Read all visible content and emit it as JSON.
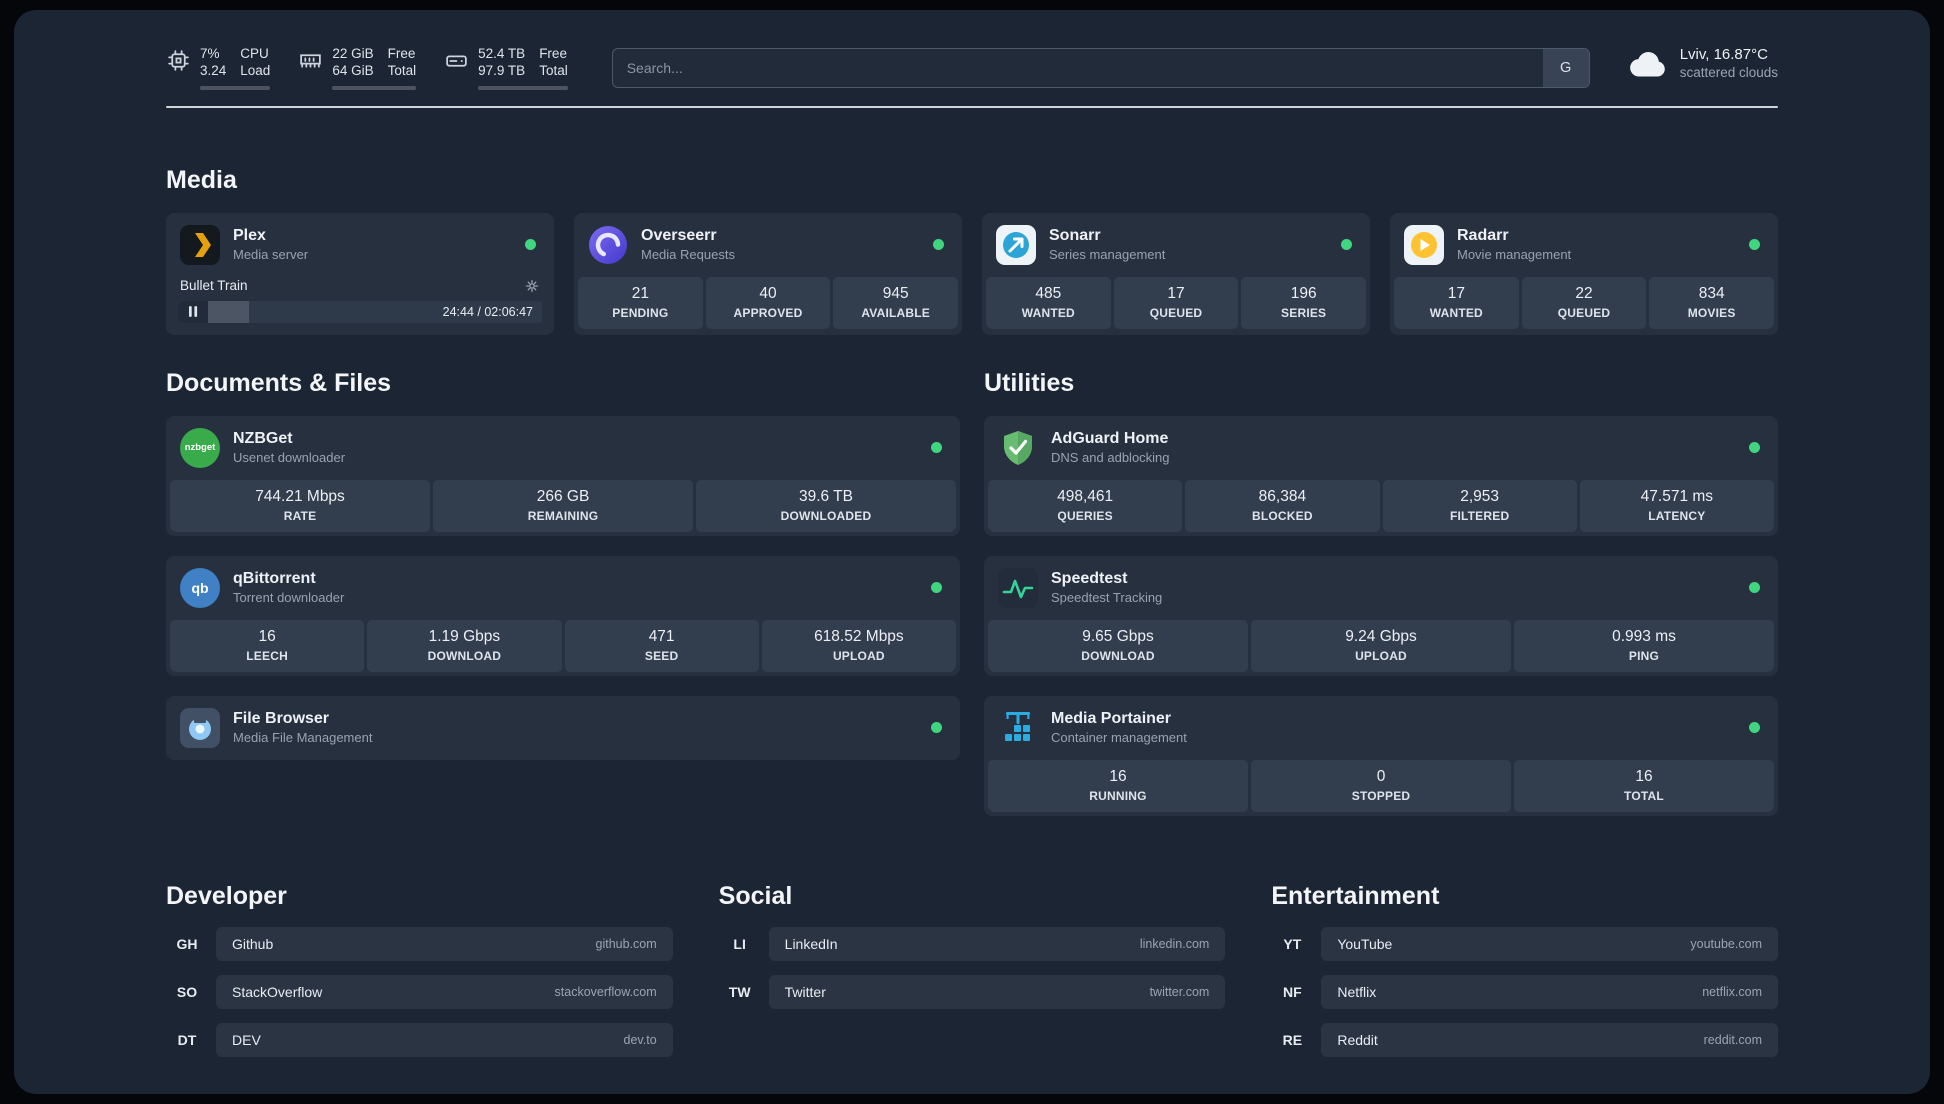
{
  "colors": {
    "status_green": "#3fd67f",
    "plex_amber": "#e5a00d",
    "adguard_green": "#68bc71",
    "portainer_blue": "#2aabe2",
    "speedtest_green": "#34d399"
  },
  "topbar": {
    "cpu": {
      "icon": "chip-icon",
      "percent": "7%",
      "load": "3.24",
      "label1": "CPU",
      "label2": "Load",
      "bar_percent": 7
    },
    "ram": {
      "icon": "memory-icon",
      "free": "22 GiB",
      "free_label": "Free",
      "total": "64 GiB",
      "total_label": "Total",
      "bar_percent": 66
    },
    "disk": {
      "icon": "hdd-icon",
      "free": "52.4 TB",
      "free_label": "Free",
      "total": "97.9 TB",
      "total_label": "Total",
      "bar_percent": 47
    },
    "search": {
      "placeholder": "Search...",
      "engine": "G"
    },
    "weather": {
      "icon": "cloud-icon",
      "location_temp": "Lviv, 16.87°C",
      "condition": "scattered clouds"
    }
  },
  "media": {
    "title": "Media",
    "plex": {
      "icon": "plex-icon",
      "name": "Plex",
      "subtitle": "Media server",
      "now_playing": "Bullet Train",
      "time": "24:44 / 02:06:47",
      "progress_percent": 19.5
    },
    "services": [
      {
        "icon": "overseerr-icon",
        "name": "Overseerr",
        "subtitle": "Media Requests",
        "stats": [
          {
            "value": "21",
            "label": "PENDING"
          },
          {
            "value": "40",
            "label": "APPROVED"
          },
          {
            "value": "945",
            "label": "AVAILABLE"
          }
        ]
      },
      {
        "icon": "sonarr-icon",
        "name": "Sonarr",
        "subtitle": "Series management",
        "stats": [
          {
            "value": "485",
            "label": "WANTED"
          },
          {
            "value": "17",
            "label": "QUEUED"
          },
          {
            "value": "196",
            "label": "SERIES"
          }
        ]
      },
      {
        "icon": "radarr-icon",
        "name": "Radarr",
        "subtitle": "Movie management",
        "stats": [
          {
            "value": "17",
            "label": "WANTED"
          },
          {
            "value": "22",
            "label": "QUEUED"
          },
          {
            "value": "834",
            "label": "MOVIES"
          }
        ]
      }
    ]
  },
  "documents": {
    "title": "Documents & Files",
    "services": [
      {
        "icon": "nzbget-icon",
        "name": "NZBGet",
        "subtitle": "Usenet downloader",
        "stats": [
          {
            "value": "744.21 Mbps",
            "label": "RATE"
          },
          {
            "value": "266 GB",
            "label": "REMAINING"
          },
          {
            "value": "39.6 TB",
            "label": "DOWNLOADED"
          }
        ]
      },
      {
        "icon": "qbittorrent-icon",
        "name": "qBittorrent",
        "subtitle": "Torrent downloader",
        "stats": [
          {
            "value": "16",
            "label": "LEECH"
          },
          {
            "value": "1.19 Gbps",
            "label": "DOWNLOAD"
          },
          {
            "value": "471",
            "label": "SEED"
          },
          {
            "value": "618.52 Mbps",
            "label": "UPLOAD"
          }
        ]
      },
      {
        "icon": "filebrowser-icon",
        "name": "File Browser",
        "subtitle": "Media File Management",
        "stats": []
      }
    ]
  },
  "utilities": {
    "title": "Utilities",
    "services": [
      {
        "icon": "adguard-icon",
        "name": "AdGuard Home",
        "subtitle": "DNS and adblocking",
        "stats": [
          {
            "value": "498,461",
            "label": "QUERIES"
          },
          {
            "value": "86,384",
            "label": "BLOCKED"
          },
          {
            "value": "2,953",
            "label": "FILTERED"
          },
          {
            "value": "47.571 ms",
            "label": "LATENCY"
          }
        ]
      },
      {
        "icon": "speedtest-icon",
        "name": "Speedtest",
        "subtitle": "Speedtest Tracking",
        "stats": [
          {
            "value": "9.65 Gbps",
            "label": "DOWNLOAD"
          },
          {
            "value": "9.24 Gbps",
            "label": "UPLOAD"
          },
          {
            "value": "0.993 ms",
            "label": "PING"
          }
        ]
      },
      {
        "icon": "portainer-icon",
        "name": "Media Portainer",
        "subtitle": "Container management",
        "stats": [
          {
            "value": "16",
            "label": "RUNNING"
          },
          {
            "value": "0",
            "label": "STOPPED"
          },
          {
            "value": "16",
            "label": "TOTAL"
          }
        ]
      }
    ]
  },
  "bookmarks": [
    {
      "title": "Developer",
      "links": [
        {
          "abbr": "GH",
          "name": "Github",
          "domain": "github.com"
        },
        {
          "abbr": "SO",
          "name": "StackOverflow",
          "domain": "stackoverflow.com"
        },
        {
          "abbr": "DT",
          "name": "DEV",
          "domain": "dev.to"
        }
      ]
    },
    {
      "title": "Social",
      "links": [
        {
          "abbr": "LI",
          "name": "LinkedIn",
          "domain": "linkedin.com"
        },
        {
          "abbr": "TW",
          "name": "Twitter",
          "domain": "twitter.com"
        }
      ]
    },
    {
      "title": "Entertainment",
      "links": [
        {
          "abbr": "YT",
          "name": "YouTube",
          "domain": "youtube.com"
        },
        {
          "abbr": "NF",
          "name": "Netflix",
          "domain": "netflix.com"
        },
        {
          "abbr": "RE",
          "name": "Reddit",
          "domain": "reddit.com"
        }
      ]
    }
  ]
}
